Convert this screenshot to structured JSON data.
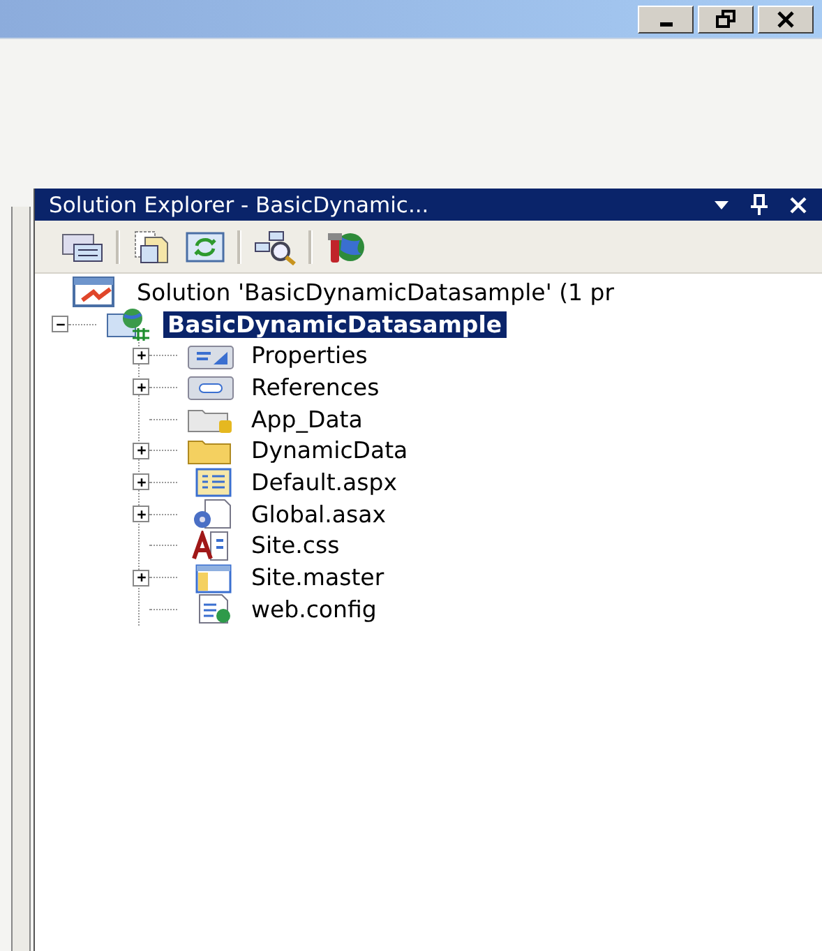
{
  "panel": {
    "title": "Solution Explorer - BasicDynamic..."
  },
  "tree": {
    "label": "Solution 'BasicDynamicDatasample' (1 pr",
    "children": [
      {
        "label": "BasicDynamicDatasample",
        "selected": true,
        "expandable": true,
        "expanded": true,
        "children": [
          {
            "label": "Properties",
            "selected": false,
            "expandable": true,
            "expanded": false
          },
          {
            "label": "References",
            "selected": false,
            "expandable": true,
            "expanded": false
          },
          {
            "label": "App_Data",
            "selected": false,
            "expandable": false
          },
          {
            "label": "DynamicData",
            "selected": false,
            "expandable": true,
            "expanded": false
          },
          {
            "label": "Default.aspx",
            "selected": false,
            "expandable": true,
            "expanded": false
          },
          {
            "label": "Global.asax",
            "selected": false,
            "expandable": true,
            "expanded": false
          },
          {
            "label": "Site.css",
            "selected": false,
            "expandable": false
          },
          {
            "label": "Site.master",
            "selected": false,
            "expandable": true,
            "expanded": false
          },
          {
            "label": "web.config",
            "selected": false,
            "expandable": false
          }
        ]
      }
    ]
  }
}
